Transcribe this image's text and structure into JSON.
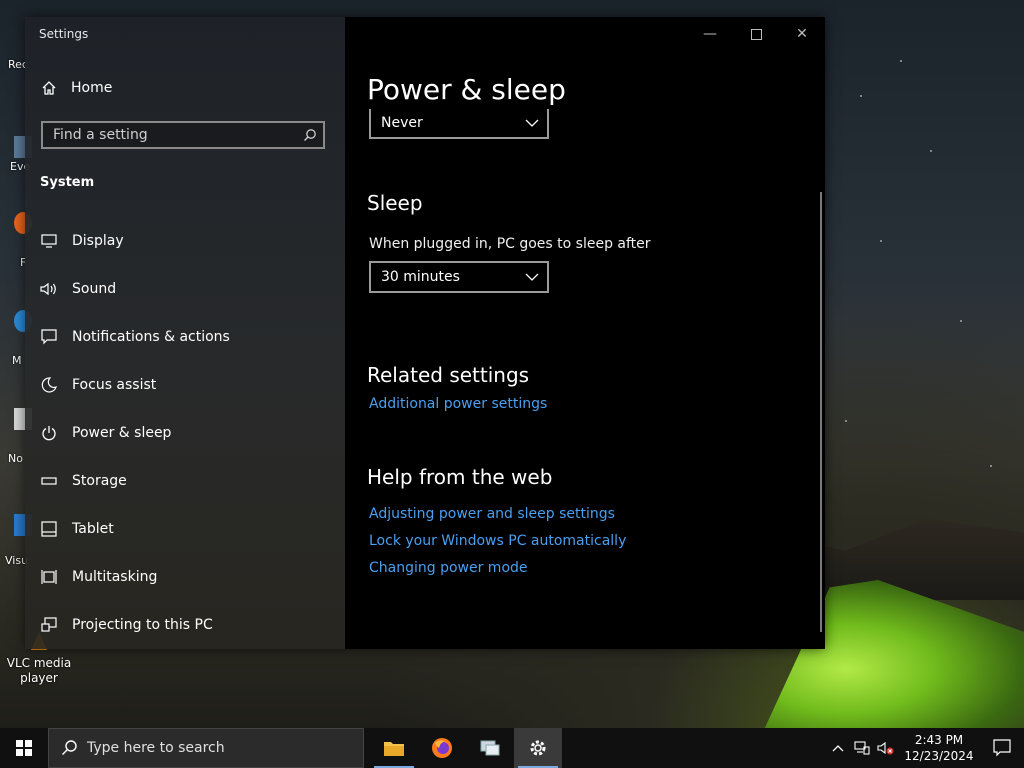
{
  "window": {
    "title": "Settings"
  },
  "sidebar": {
    "home_label": "Home",
    "search_placeholder": "Find a setting",
    "section": "System",
    "items": [
      {
        "label": "Display",
        "icon": "display-icon"
      },
      {
        "label": "Sound",
        "icon": "sound-icon"
      },
      {
        "label": "Notifications & actions",
        "icon": "notifications-icon"
      },
      {
        "label": "Focus assist",
        "icon": "focus-assist-icon"
      },
      {
        "label": "Power & sleep",
        "icon": "power-icon"
      },
      {
        "label": "Storage",
        "icon": "storage-icon"
      },
      {
        "label": "Tablet",
        "icon": "tablet-icon"
      },
      {
        "label": "Multitasking",
        "icon": "multitasking-icon"
      },
      {
        "label": "Projecting to this PC",
        "icon": "projecting-icon"
      }
    ]
  },
  "main": {
    "title": "Power & sleep",
    "screen_dropdown_value": "Never",
    "sleep": {
      "heading": "Sleep",
      "plugged_label": "When plugged in, PC goes to sleep after",
      "plugged_value": "30 minutes"
    },
    "related": {
      "heading": "Related settings",
      "links": [
        "Additional power settings"
      ]
    },
    "help": {
      "heading": "Help from the web",
      "links": [
        "Adjusting power and sleep settings",
        "Lock your Windows PC automatically",
        "Changing power mode"
      ]
    }
  },
  "desktop": {
    "icon_labels": [
      "Rec",
      "Eve",
      "F",
      "M",
      "No",
      "Visu"
    ],
    "vlc_label": "VLC media player"
  },
  "taskbar": {
    "search_placeholder": "Type here to search",
    "apps": [
      "file-explorer-icon",
      "firefox-icon",
      "network-app-icon",
      "settings-gear-icon"
    ],
    "time": "2:43 PM",
    "date": "12/23/2024"
  },
  "colors": {
    "link": "#4a9ff0",
    "content_bg": "#000000",
    "taskbar_bg": "#101010"
  }
}
